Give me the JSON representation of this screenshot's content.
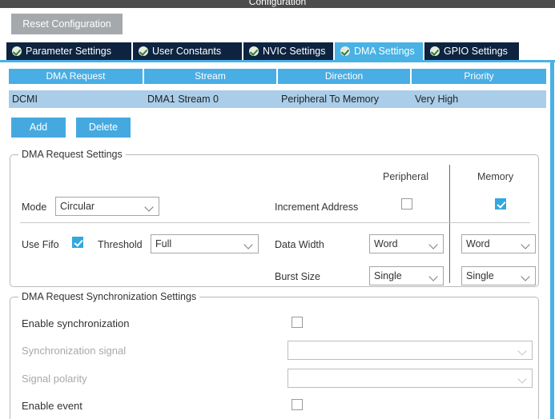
{
  "window": {
    "title": "Configuration"
  },
  "toolbar": {
    "reset_label": "Reset Configuration"
  },
  "tabs": [
    {
      "label": "Parameter Settings",
      "icon": "check-circle-icon",
      "active": false
    },
    {
      "label": "User Constants",
      "icon": "check-circle-icon",
      "active": false
    },
    {
      "label": "NVIC Settings",
      "icon": "check-circle-icon",
      "active": false
    },
    {
      "label": "DMA Settings",
      "icon": "check-circle-icon",
      "active": true
    },
    {
      "label": "GPIO Settings",
      "icon": "check-circle-icon",
      "active": false
    }
  ],
  "dma_table": {
    "columns": [
      "DMA Request",
      "Stream",
      "Direction",
      "Priority"
    ],
    "rows": [
      {
        "dma_request": "DCMI",
        "stream": "DMA1 Stream 0",
        "direction": "Peripheral To Memory",
        "priority": "Very High",
        "selected": true
      }
    ]
  },
  "table_actions": {
    "add_label": "Add",
    "delete_label": "Delete"
  },
  "request_settings": {
    "title": "DMA Request Settings",
    "column_headers": {
      "peripheral": "Peripheral",
      "memory": "Memory"
    },
    "mode": {
      "label": "Mode",
      "value": "Circular"
    },
    "increment_address": {
      "label": "Increment Address",
      "peripheral_checked": false,
      "memory_checked": true
    },
    "use_fifo": {
      "label": "Use Fifo",
      "checked": true
    },
    "threshold": {
      "label": "Threshold",
      "value": "Full"
    },
    "data_width": {
      "label": "Data Width",
      "peripheral_value": "Word",
      "memory_value": "Word"
    },
    "burst_size": {
      "label": "Burst Size",
      "peripheral_value": "Single",
      "memory_value": "Single"
    }
  },
  "sync_settings": {
    "title": "DMA Request Synchronization Settings",
    "enable_synchronization": {
      "label": "Enable synchronization",
      "checked": false
    },
    "synchronization_signal": {
      "label": "Synchronization signal",
      "value": "",
      "disabled": true
    },
    "signal_polarity": {
      "label": "Signal polarity",
      "value": "",
      "disabled": true
    },
    "enable_event": {
      "label": "Enable event",
      "checked": false
    }
  },
  "colors": {
    "accent_blue": "#49b1e4",
    "tab_inactive": "#0d2340",
    "table_header": "#49aee4",
    "row_selected": "#aacde9",
    "reset_button": "#a5a9ac",
    "checkbox_on": "#31a8e0"
  }
}
